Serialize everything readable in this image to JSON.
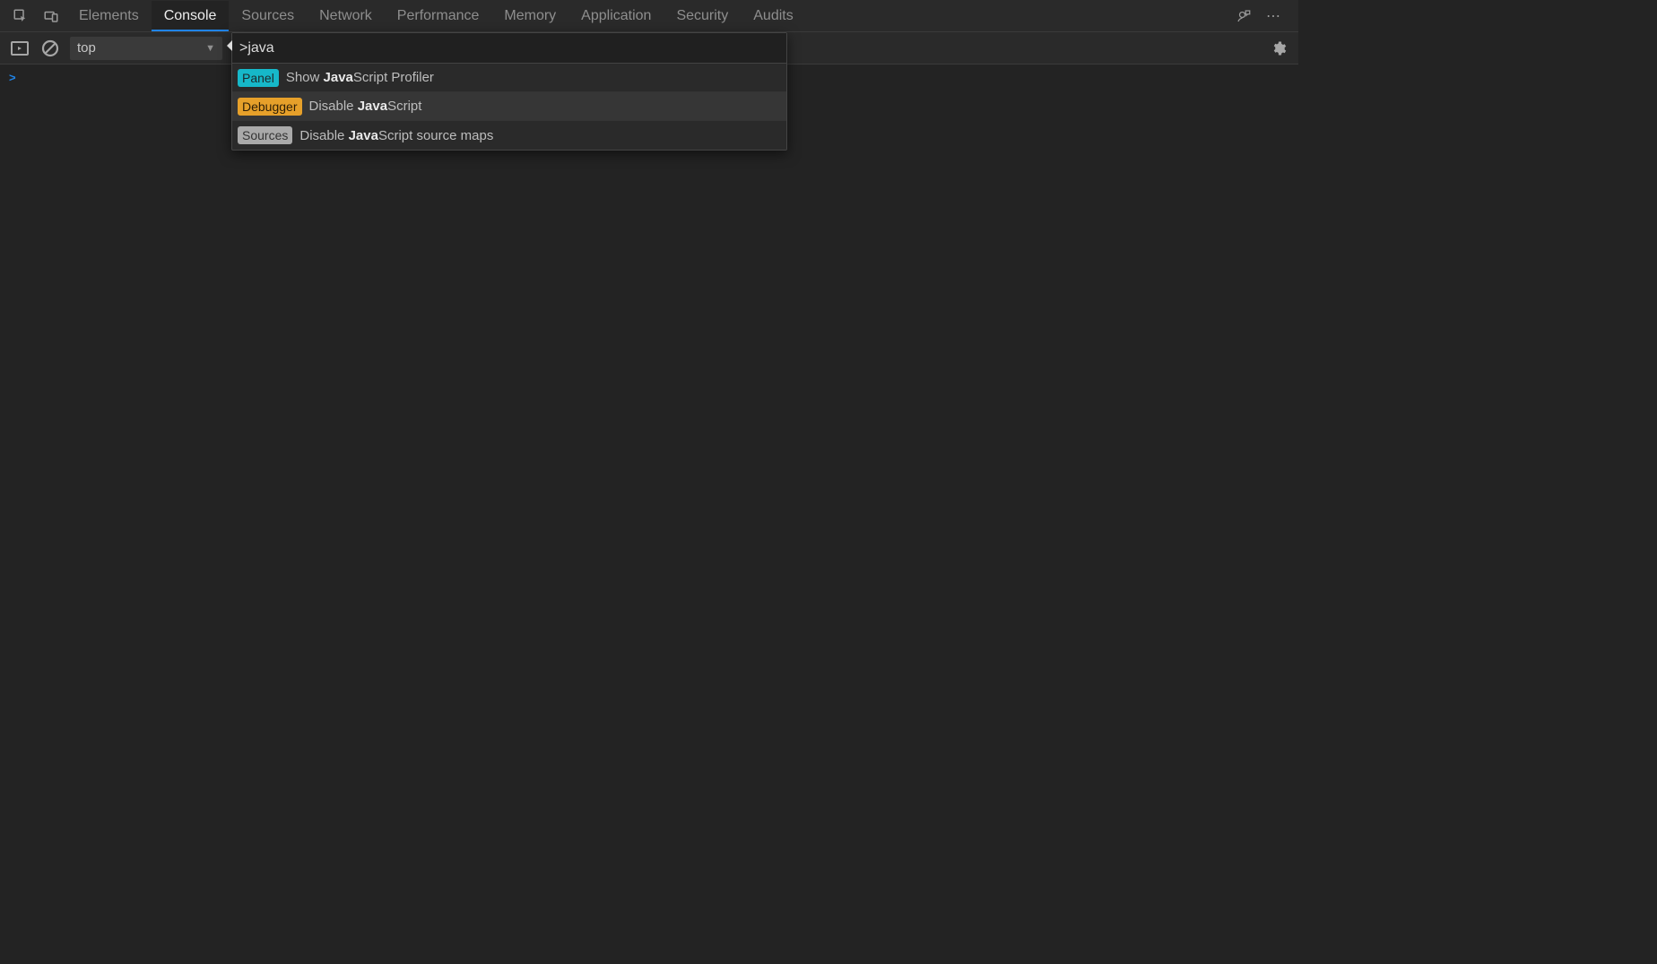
{
  "tabs": {
    "items": [
      "Elements",
      "Console",
      "Sources",
      "Network",
      "Performance",
      "Memory",
      "Application",
      "Security",
      "Audits"
    ],
    "active": "Console"
  },
  "subbar": {
    "context": "top"
  },
  "palette": {
    "input_value": ">java",
    "items": [
      {
        "badge": "Panel",
        "badge_color": "teal",
        "pre": "Show ",
        "match": "Java",
        "post": "Script Profiler",
        "hovered": false
      },
      {
        "badge": "Debugger",
        "badge_color": "orange",
        "pre": "Disable ",
        "match": "Java",
        "post": "Script",
        "hovered": true
      },
      {
        "badge": "Sources",
        "badge_color": "grey",
        "pre": "Disable ",
        "match": "Java",
        "post": "Script source maps",
        "hovered": false
      }
    ]
  },
  "console": {
    "prompt": ">"
  }
}
